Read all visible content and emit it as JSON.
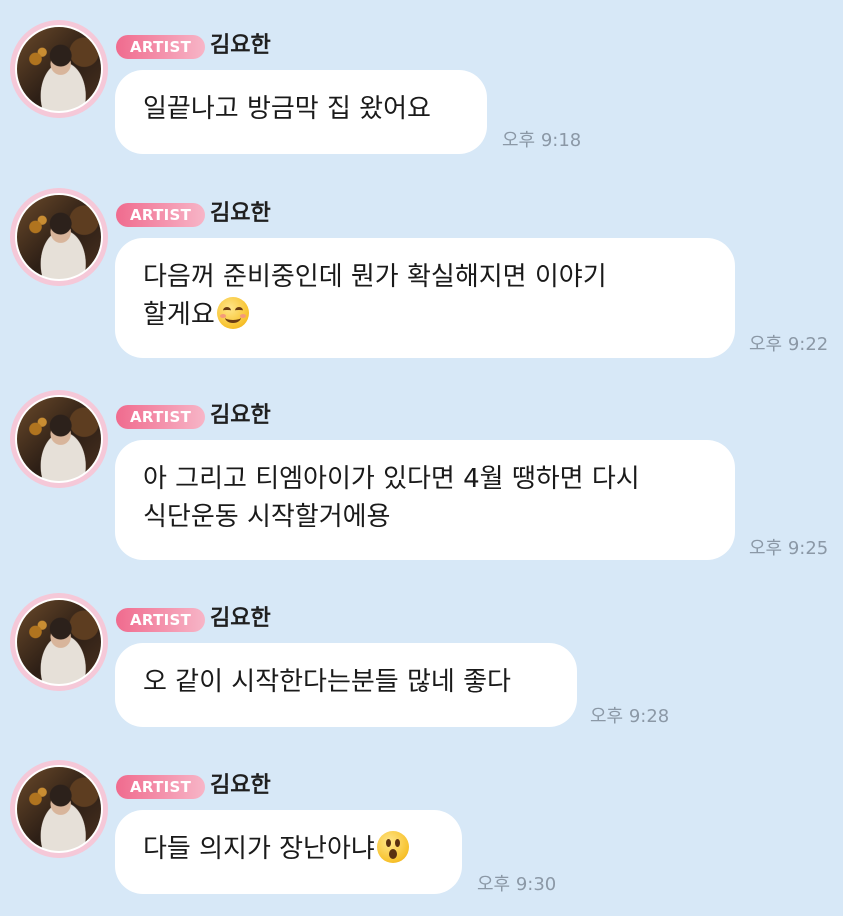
{
  "badge_label": "ARTIST",
  "messages": [
    {
      "sender": "김요한",
      "text": "일끝나고 방금막 집 왔어요",
      "time": "오후 9:18"
    },
    {
      "sender": "김요한",
      "line1": "다음꺼 준비중인데 뭔가 확실해지면 이야기",
      "line2": "할게요",
      "emoji": "smiling-face-emoji",
      "time": "오후 9:22"
    },
    {
      "sender": "김요한",
      "line1": "아 그리고 티엠아이가 있다면 4월 땡하면 다시",
      "line2": "식단운동 시작할거에용",
      "time": "오후 9:25"
    },
    {
      "sender": "김요한",
      "text": "오 같이 시작한다는분들 많네 좋다",
      "time": "오후 9:28"
    },
    {
      "sender": "김요한",
      "text": "다들 의지가 장난아냐",
      "emoji": "astonished-face-emoji",
      "time": "오후 9:30"
    }
  ],
  "colors": {
    "background": "#d7e8f7",
    "bubble": "#ffffff",
    "badge_start": "#f06b8e",
    "badge_end": "#f7b5c7",
    "time_text": "#8b98a6"
  }
}
